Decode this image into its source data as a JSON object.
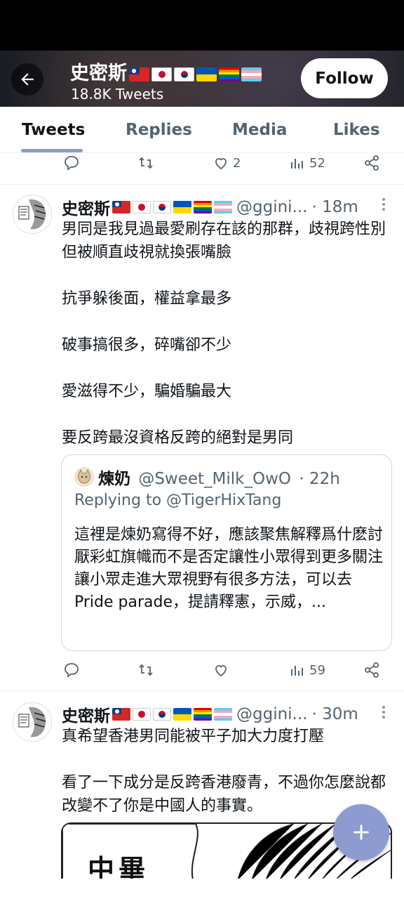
{
  "header": {
    "name": "史密斯",
    "tweet_count": "18.8K Tweets",
    "follow_label": "Follow"
  },
  "tabs": [
    {
      "label": "Tweets",
      "active": true
    },
    {
      "label": "Replies",
      "active": false
    },
    {
      "label": "Media",
      "active": false
    },
    {
      "label": "Likes",
      "active": false
    }
  ],
  "flags": [
    "flag-taiwan-icon",
    "flag-japan-icon",
    "flag-south-korea-icon",
    "flag-ukraine-icon",
    "flag-rainbow-icon",
    "flag-transgender-icon"
  ],
  "top_actions": {
    "likes": "2",
    "views": "52"
  },
  "tweets": [
    {
      "name": "史密斯",
      "handle": "@ggini...",
      "time": "· 18m",
      "text": "男同是我見過最愛刷存在該的那群，歧視跨性別 但被順直歧視就換張嘴臉\n\n抗爭躲後面，權益拿最多\n\n破事搞很多，碎嘴卻不少\n\n愛滋得不少，騙婚騙最大\n\n要反跨最沒資格反跨的絕對是男同",
      "quote": {
        "name": "煉奶",
        "handle": "@Sweet_Milk_OwO",
        "time": "· 22h",
        "replying": "Replying to @TigerHixTang",
        "text": "這裡是煉奶寫得不好，應該聚焦解釋爲什麽討厭彩虹旗幟而不是否定讓性小眾得到更多關注\n讓小眾走進大眾視野有很多方法，可以去Pride parade，提請釋憲，示威，..."
      },
      "actions": {
        "views": "59"
      }
    },
    {
      "name": "史密斯",
      "handle": "@ggini...",
      "time": "· 30m",
      "text": "真希望香港男同能被平子加大力度打壓\n\n看了一下成分是反跨香港廢青，不過你怎麼說都改變不了你是中國人的事實。",
      "media_text": "中畢"
    }
  ],
  "colors": {
    "accent": "#8e9bd0",
    "text_primary": "#0f1419",
    "text_secondary": "#536471",
    "border": "#cfd9de"
  }
}
